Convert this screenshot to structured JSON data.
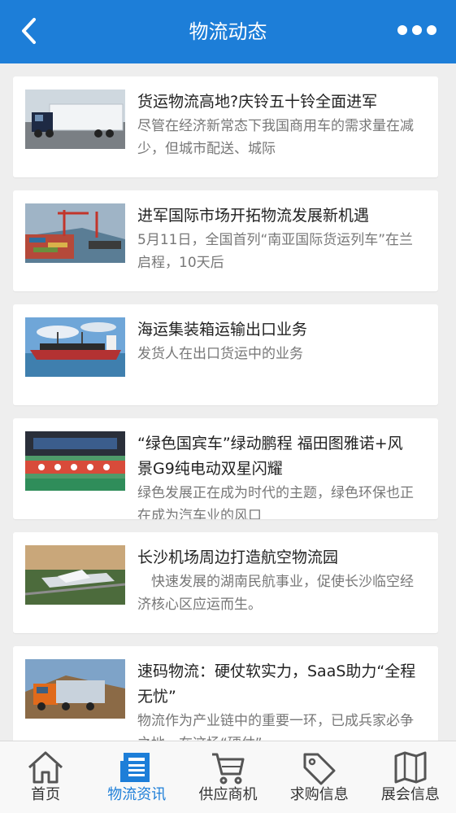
{
  "header": {
    "title": "物流动态"
  },
  "articles": [
    {
      "title": "货运物流高地?庆铃五十铃全面进军",
      "summary": "尽管在经济新常态下我国商用车的需求量在减少，但城市配送、城际"
    },
    {
      "title": "进军国际市场开拓物流发展新机遇",
      "summary": "5月11日，全国首列“南亚国际货运列车”在兰启程，10天后"
    },
    {
      "title": "海运集装箱运输出口业务",
      "summary": "发货人在出口货运中的业务"
    },
    {
      "title": "“绿色国宾车”绿动鹏程 福田图雅诺+风景G9纯电动双星闪耀",
      "summary": "绿色发展正在成为时代的主题，绿色环保也正在成为汽车业的风口"
    },
    {
      "title": "长沙机场周边打造航空物流园",
      "summary": "　快速发展的湖南民航事业，促使长沙临空经济核心区应运而生。"
    },
    {
      "title": "速码物流：硬仗软实力，SaaS助力“全程无忧”",
      "summary": "物流作为产业链中的重要一环，已成兵家必争之地，在这场“硬仗”"
    }
  ],
  "tabs": [
    {
      "label": "首页",
      "icon": "home-icon"
    },
    {
      "label": "物流资讯",
      "icon": "news-icon"
    },
    {
      "label": "供应商机",
      "icon": "cart-icon"
    },
    {
      "label": "求购信息",
      "icon": "tag-icon"
    },
    {
      "label": "展会信息",
      "icon": "map-icon"
    }
  ],
  "active_tab": "物流资讯",
  "colors": {
    "primary": "#1d7ed8",
    "background": "#eeeeee",
    "card": "#ffffff",
    "title_text": "#222222",
    "summary_text": "#777777"
  }
}
